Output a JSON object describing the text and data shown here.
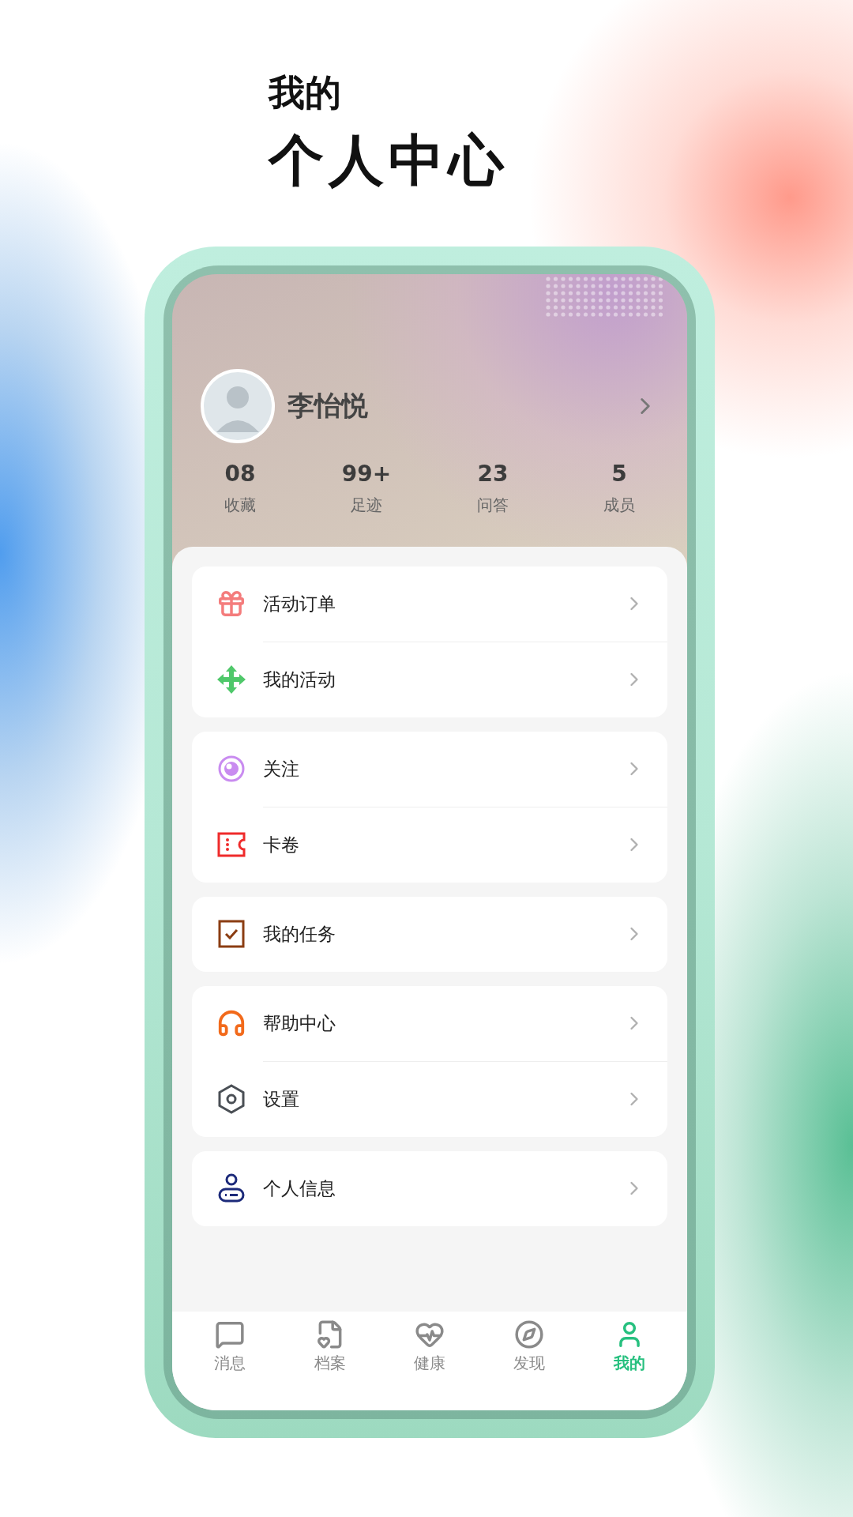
{
  "heading": {
    "subtitle": "我的",
    "title": "个人中心"
  },
  "profile": {
    "name": "李怡悦"
  },
  "stats": [
    {
      "value": "08",
      "label": "收藏"
    },
    {
      "value": "99+",
      "label": "足迹"
    },
    {
      "value": "23",
      "label": "问答"
    },
    {
      "value": "5",
      "label": "成员"
    }
  ],
  "menu_groups": [
    {
      "items": [
        {
          "label": "活动订单"
        },
        {
          "label": "我的活动"
        }
      ]
    },
    {
      "items": [
        {
          "label": "关注"
        },
        {
          "label": "卡卷"
        }
      ]
    },
    {
      "items": [
        {
          "label": "我的任务"
        }
      ]
    },
    {
      "items": [
        {
          "label": "帮助中心"
        },
        {
          "label": "设置"
        }
      ]
    },
    {
      "items": [
        {
          "label": "个人信息"
        }
      ]
    }
  ],
  "tab_bar": [
    {
      "label": "消息",
      "selected": false
    },
    {
      "label": "档案",
      "selected": false
    },
    {
      "label": "健康",
      "selected": false
    },
    {
      "label": "发现",
      "selected": false
    },
    {
      "label": "我的",
      "selected": true
    }
  ]
}
